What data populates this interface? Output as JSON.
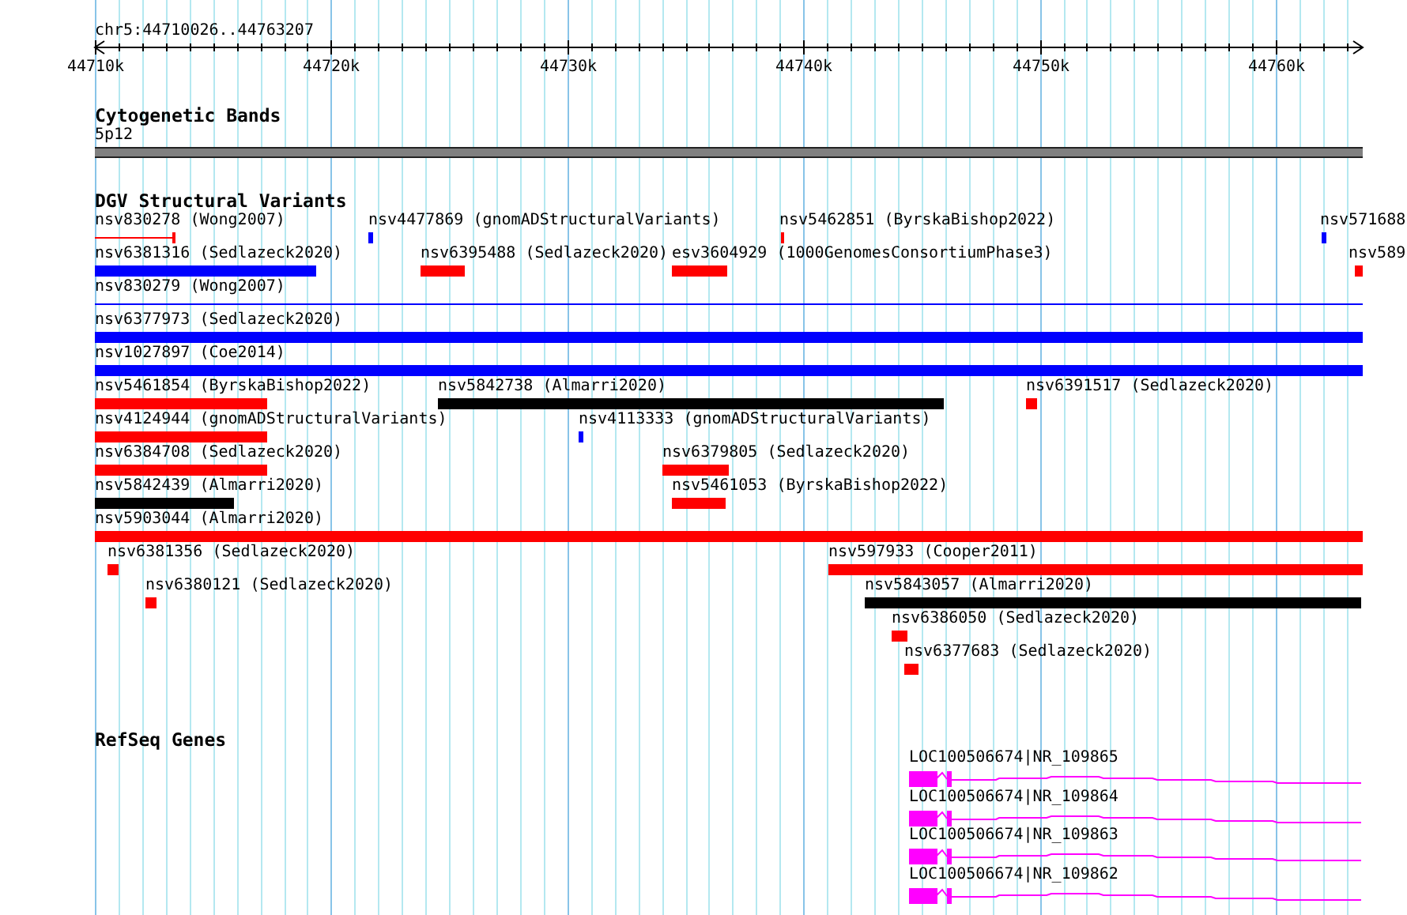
{
  "ruler": {
    "location": "chr5:44710026..44763207",
    "ticks": [
      "44710k",
      "44720k",
      "44730k",
      "44740k",
      "44750k",
      "44760k"
    ]
  },
  "cytogenetic_bands": {
    "title": "Cytogenetic Bands",
    "band": "5p12"
  },
  "dgv_structural_variants": {
    "title": "DGV Structural Variants",
    "features": [
      {
        "label": "nsv830278 (Wong2007)",
        "kind": "line",
        "color": "#ff0000"
      },
      {
        "label": "nsv4477869 (gnomADStructuralVariants)",
        "kind": "bar",
        "color": "#0000ff"
      },
      {
        "label": "nsv5462851 (ByrskaBishop2022)",
        "kind": "bar",
        "color": "#ff0000"
      },
      {
        "label": "nsv571688",
        "kind": "bar",
        "color": "#0000ff"
      },
      {
        "label": "nsv6381316 (Sedlazeck2020)",
        "kind": "bar",
        "color": "#0000ff"
      },
      {
        "label": "nsv6395488 (Sedlazeck2020)",
        "kind": "bar",
        "color": "#ff0000"
      },
      {
        "label": "esv3604929 (1000GenomesConsortiumPhase3)",
        "kind": "bar",
        "color": "#ff0000"
      },
      {
        "label": "nsv589",
        "kind": "bar",
        "color": "#ff0000"
      },
      {
        "label": "nsv830279 (Wong2007)",
        "kind": "line",
        "color": "#0000ff"
      },
      {
        "label": "nsv6377973 (Sedlazeck2020)",
        "kind": "bar",
        "color": "#0000ff"
      },
      {
        "label": "nsv1027897 (Coe2014)",
        "kind": "bar",
        "color": "#0000ff"
      },
      {
        "label": "nsv5461854 (ByrskaBishop2022)",
        "kind": "bar",
        "color": "#ff0000"
      },
      {
        "label": "nsv5842738 (Almarri2020)",
        "kind": "bar",
        "color": "#000000"
      },
      {
        "label": "nsv6391517 (Sedlazeck2020)",
        "kind": "bar",
        "color": "#ff0000"
      },
      {
        "label": "nsv4124944 (gnomADStructuralVariants)",
        "kind": "bar",
        "color": "#ff0000"
      },
      {
        "label": "nsv4113333 (gnomADStructuralVariants)",
        "kind": "bar",
        "color": "#0000ff"
      },
      {
        "label": "nsv6384708 (Sedlazeck2020)",
        "kind": "bar",
        "color": "#ff0000"
      },
      {
        "label": "nsv6379805 (Sedlazeck2020)",
        "kind": "bar",
        "color": "#ff0000"
      },
      {
        "label": "nsv5842439 (Almarri2020)",
        "kind": "bar",
        "color": "#000000"
      },
      {
        "label": "nsv5461053 (ByrskaBishop2022)",
        "kind": "bar",
        "color": "#ff0000"
      },
      {
        "label": "nsv5903044 (Almarri2020)",
        "kind": "bar",
        "color": "#ff0000"
      },
      {
        "label": "nsv6381356 (Sedlazeck2020)",
        "kind": "bar",
        "color": "#ff0000"
      },
      {
        "label": "nsv597933 (Cooper2011)",
        "kind": "bar",
        "color": "#ff0000"
      },
      {
        "label": "nsv6380121 (Sedlazeck2020)",
        "kind": "bar",
        "color": "#ff0000"
      },
      {
        "label": "nsv5843057 (Almarri2020)",
        "kind": "bar",
        "color": "#000000"
      },
      {
        "label": "nsv6386050 (Sedlazeck2020)",
        "kind": "bar",
        "color": "#ff0000"
      },
      {
        "label": "nsv6377683 (Sedlazeck2020)",
        "kind": "bar",
        "color": "#ff0000"
      }
    ]
  },
  "refseq_genes": {
    "title": "RefSeq Genes",
    "genes": [
      {
        "label": "LOC100506674|NR_109865"
      },
      {
        "label": "LOC100506674|NR_109864"
      },
      {
        "label": "LOC100506674|NR_109863"
      },
      {
        "label": "LOC100506674|NR_109862"
      }
    ]
  }
}
